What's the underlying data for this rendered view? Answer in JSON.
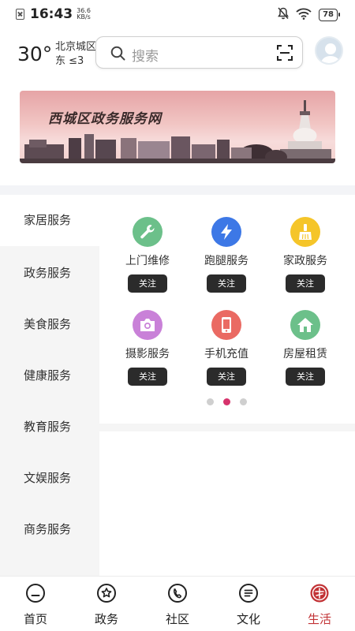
{
  "status_bar": {
    "time": "16:43",
    "speed_value": "36.6",
    "speed_unit": "KB/s",
    "battery": "78"
  },
  "weather": {
    "temperature": "30°",
    "district": "北京城区",
    "wind": "东 ≤3"
  },
  "search": {
    "placeholder": "搜索"
  },
  "banner": {
    "title": "西城区政务服务网"
  },
  "sidebar": {
    "items": [
      {
        "label": "家居服务"
      },
      {
        "label": "政务服务"
      },
      {
        "label": "美食服务"
      },
      {
        "label": "健康服务"
      },
      {
        "label": "教育服务"
      },
      {
        "label": "文娱服务"
      },
      {
        "label": "商务服务"
      }
    ]
  },
  "services": [
    {
      "label": "上门维修",
      "follow": "关注",
      "icon": "wrench-icon",
      "color": "#6cc08a"
    },
    {
      "label": "跑腿服务",
      "follow": "关注",
      "icon": "lightning-icon",
      "color": "#3d78e6"
    },
    {
      "label": "家政服务",
      "follow": "关注",
      "icon": "broom-icon",
      "color": "#f5c529"
    },
    {
      "label": "摄影服务",
      "follow": "关注",
      "icon": "camera-icon",
      "color": "#c981d8"
    },
    {
      "label": "手机充值",
      "follow": "关注",
      "icon": "phone-icon",
      "color": "#ea6a63"
    },
    {
      "label": "房屋租赁",
      "follow": "关注",
      "icon": "house-icon",
      "color": "#6cc08a"
    }
  ],
  "pagination": {
    "pages": 3,
    "current": 2
  },
  "bottom_nav": [
    {
      "label": "首页",
      "icon": "home-icon"
    },
    {
      "label": "政务",
      "icon": "government-icon"
    },
    {
      "label": "社区",
      "icon": "community-icon"
    },
    {
      "label": "文化",
      "icon": "culture-icon"
    },
    {
      "label": "生活",
      "icon": "life-icon",
      "active": true
    }
  ],
  "colors": {
    "accent": "#c23235",
    "dot_active": "#d6336c",
    "follow_button": "#2b2b2b",
    "sidebar_bg": "#f5f5f5"
  }
}
